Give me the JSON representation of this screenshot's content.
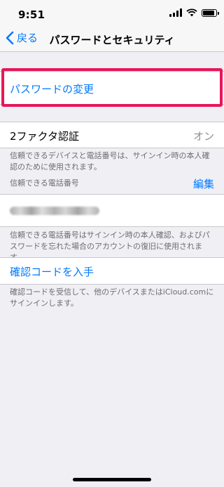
{
  "status_bar": {
    "time": "9:51",
    "icons": [
      "signal-icon",
      "wifi-icon",
      "battery-icon"
    ]
  },
  "nav": {
    "back_label": "戻る",
    "title": "パスワードとセキュリティ"
  },
  "change_password": {
    "label": "パスワードの変更"
  },
  "two_factor": {
    "label": "2ファクタ認証",
    "value": "オン",
    "footer": "信頼できるデバイスと電話番号は、サインイン時の本人確認のために使用されます。"
  },
  "trusted_numbers": {
    "header": "信頼できる電話番号",
    "edit_label": "編集",
    "footer": "信頼できる電話番号はサインイン時の本人確認、およびパスワードを忘れた場合のアカウントの復旧に使用されます。"
  },
  "verification_code": {
    "label": "確認コードを入手",
    "footer": "確認コードを受信して、他のデバイスまたはiCloud.comにサインインします。"
  },
  "colors": {
    "accent": "#007aff",
    "highlight": "#e8165a",
    "background": "#efeff4"
  }
}
